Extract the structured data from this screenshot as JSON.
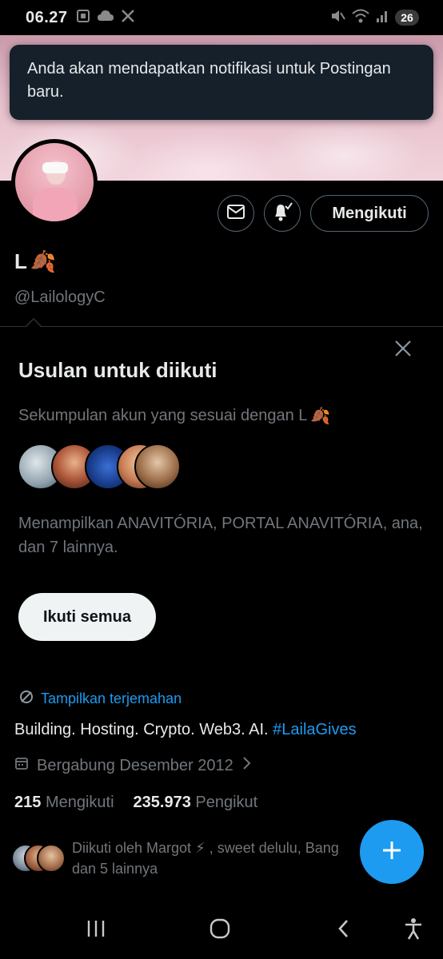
{
  "status_bar": {
    "time": "06.27",
    "battery": "26",
    "icons": [
      "screenshot-icon",
      "cloud-icon",
      "x-logo-icon",
      "mute-icon",
      "wifi-icon",
      "signal-icon"
    ]
  },
  "toast": {
    "message": "Anda akan mendapatkan notifikasi untuk Postingan baru."
  },
  "profile": {
    "display_name": "L",
    "name_emoji": "🍂",
    "handle": "@LailologyC",
    "following_button": "Mengikuti",
    "bio_text": "Building. Hosting. Crypto. Web3. AI. ",
    "bio_hashtag": "#LailaGives",
    "translate_link": "Tampilkan terjemahan",
    "joined": "Bergabung Desember 2012",
    "following_count": "215",
    "following_label": "Mengikuti",
    "followers_count": "235.973",
    "followers_label": "Pengikut",
    "followed_by": "Diikuti oleh Margot ⚡ , sweet delulu, Bang dan 5 lainnya"
  },
  "suggestions": {
    "title": "Usulan untuk diikuti",
    "subtitle": "Sekumpulan akun yang sesuai dengan L",
    "subtitle_emoji": "🍂",
    "showing": "Menampilkan ANAVITÓRIA, PORTAL ANAVITÓRIA, ana, dan 7 lainnya.",
    "follow_all_button": "Ikuti semua"
  },
  "colors": {
    "accent": "#1d9bf0",
    "toast_bg": "#15202b",
    "muted_text": "#71767b"
  }
}
